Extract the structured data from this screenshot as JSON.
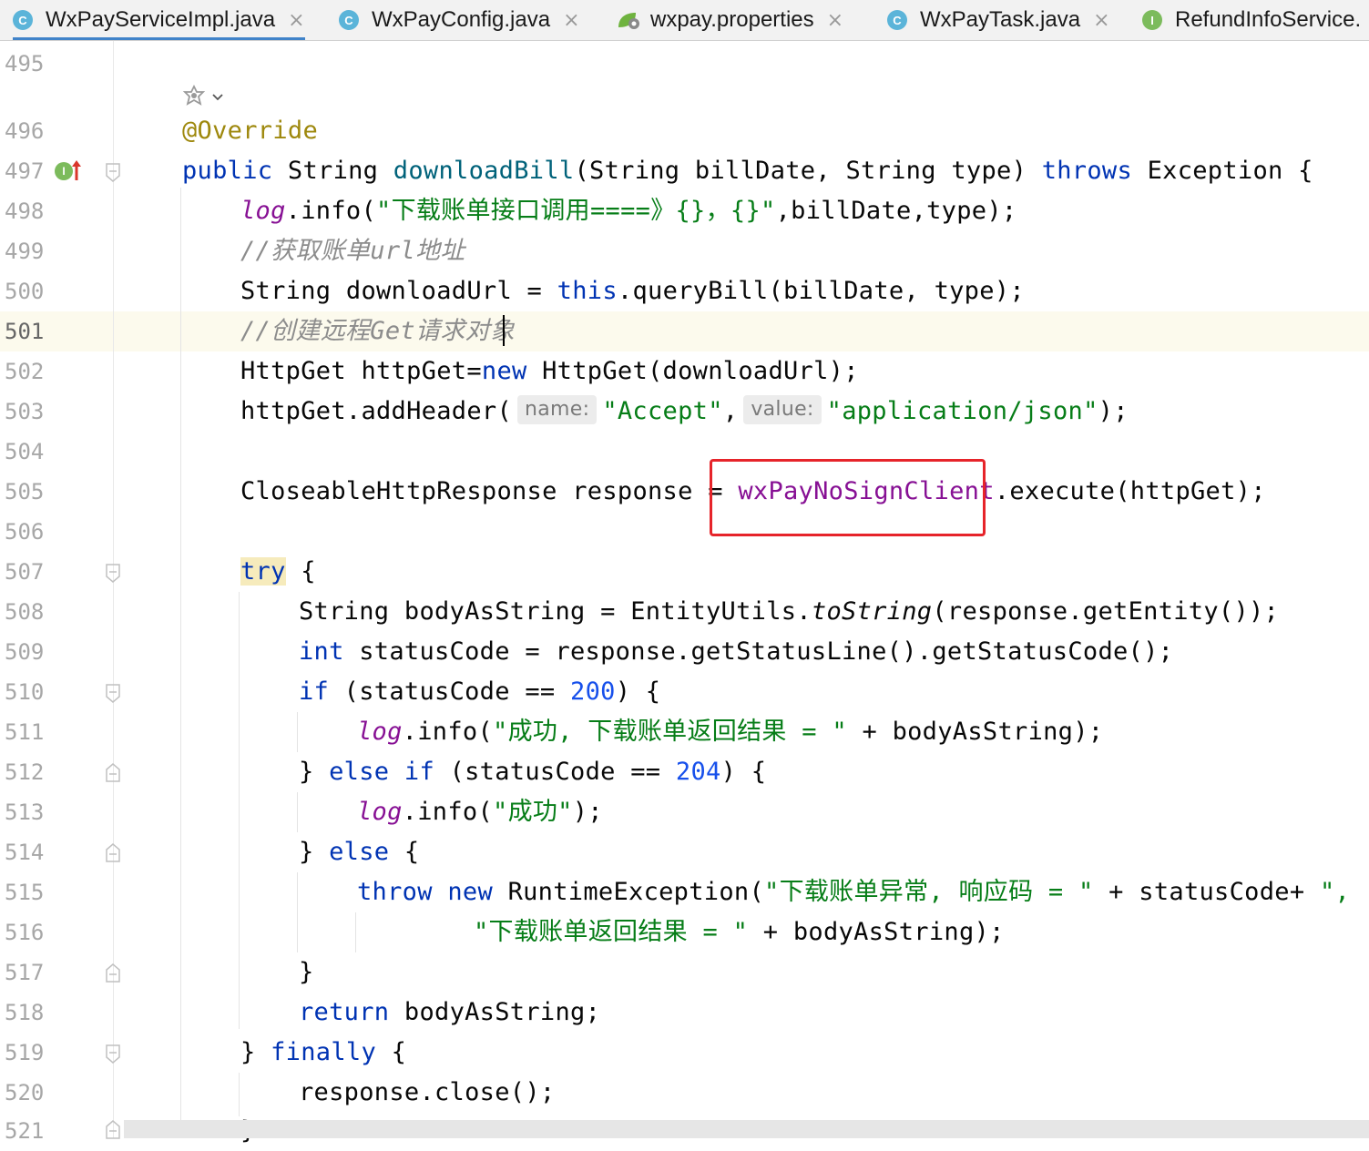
{
  "tabs": [
    {
      "label": "WxPayServiceImpl.java",
      "icon": "class-icon",
      "icon_text": "C",
      "active": true,
      "closable": true
    },
    {
      "label": "WxPayConfig.java",
      "icon": "class-icon",
      "icon_text": "C",
      "active": false,
      "closable": true
    },
    {
      "label": "wxpay.properties",
      "icon": "properties-icon",
      "icon_text": "",
      "active": false,
      "closable": true
    },
    {
      "label": "WxPayTask.java",
      "icon": "class-icon",
      "icon_text": "C",
      "active": false,
      "closable": true
    },
    {
      "label": "RefundInfoService.",
      "icon": "interface-icon",
      "icon_text": "I",
      "active": false,
      "closable": false
    }
  ],
  "tab_close_glyph": "×",
  "editor": {
    "line_numbers": [
      "495",
      "496",
      "497",
      "498",
      "499",
      "500",
      "501",
      "502",
      "503",
      "504",
      "505",
      "506",
      "507",
      "508",
      "509",
      "510",
      "511",
      "512",
      "513",
      "514",
      "515",
      "516",
      "517",
      "518",
      "519",
      "520",
      "521"
    ],
    "current_line": "501",
    "implements_marker": "I",
    "hints": {
      "name": "name:",
      "value": "value:"
    },
    "highlighted_identifier": "wxPayNoSignClient"
  },
  "colors": {
    "keyword": "#0033b3",
    "string": "#067d17",
    "number": "#1750eb",
    "annotation": "#9e880d",
    "comment": "#8c8c8c",
    "field": "#871094",
    "highlight_box": "#e6242a",
    "active_tab_underline": "#4083c9"
  },
  "code": {
    "l496": {
      "t1": "@Override"
    },
    "l497": {
      "t1": "public",
      "t2": " String ",
      "t3": "downloadBill",
      "t4": "(String billDate, String type) ",
      "t5": "throws",
      "t6": " Exception {"
    },
    "l498": {
      "t1": "log",
      "t2": ".info(",
      "t3": "\"下载账单接口调用====》{}，{}\"",
      "t4": ",billDate,type);"
    },
    "l499": {
      "t1": "//获取账单url地址"
    },
    "l500": {
      "t1": "String downloadUrl = ",
      "t2": "this",
      "t3": ".queryBill(billDate, type);"
    },
    "l501": {
      "t1": "//创建远程Get请求对象"
    },
    "l502": {
      "t1": "HttpGet httpGet=",
      "t2": "new",
      "t3": " HttpGet(downloadUrl);"
    },
    "l503": {
      "t1": "httpGet.addHeader(",
      "t2": "\"Accept\"",
      "t3": ",",
      "t4": "\"application/json\"",
      "t5": ");"
    },
    "l505": {
      "t1": "CloseableHttpResponse response = ",
      "t2": "wxPayNoSignClient",
      "t3": ".execute(httpGet);"
    },
    "l507": {
      "t1": "try",
      "t2": " {"
    },
    "l508": {
      "t1": "String bodyAsString = EntityUtils.",
      "t2": "toString",
      "t3": "(response.getEntity());"
    },
    "l509": {
      "t1": "int",
      "t2": " statusCode = response.getStatusLine().getStatusCode();"
    },
    "l510": {
      "t1": "if",
      "t2": " (statusCode == ",
      "t3": "200",
      "t4": ") {"
    },
    "l511": {
      "t1": "log",
      "t2": ".info(",
      "t3": "\"成功, 下载账单返回结果 = \"",
      "t4": " + bodyAsString);"
    },
    "l512": {
      "t1": "} ",
      "t2": "else if",
      "t3": " (statusCode == ",
      "t4": "204",
      "t5": ") {"
    },
    "l513": {
      "t1": "log",
      "t2": ".info(",
      "t3": "\"成功\"",
      "t4": ");"
    },
    "l514": {
      "t1": "} ",
      "t2": "else",
      "t3": " {"
    },
    "l515": {
      "t1": "throw",
      "t2": " ",
      "t3": "new",
      "t4": " RuntimeException(",
      "t5": "\"下载账单异常, 响应码 = \"",
      "t6": " + statusCode+ ",
      "t7": "\", \"",
      "t8": " +"
    },
    "l516": {
      "t1": "\"下载账单返回结果 = \"",
      "t2": " + bodyAsString);"
    },
    "l517": {
      "t1": "}"
    },
    "l518": {
      "t1": "return",
      "t2": " bodyAsString;"
    },
    "l519": {
      "t1": "} ",
      "t2": "finally",
      "t3": " {"
    },
    "l520": {
      "t1": "response.close();"
    },
    "l521": {
      "t1": "}"
    }
  }
}
